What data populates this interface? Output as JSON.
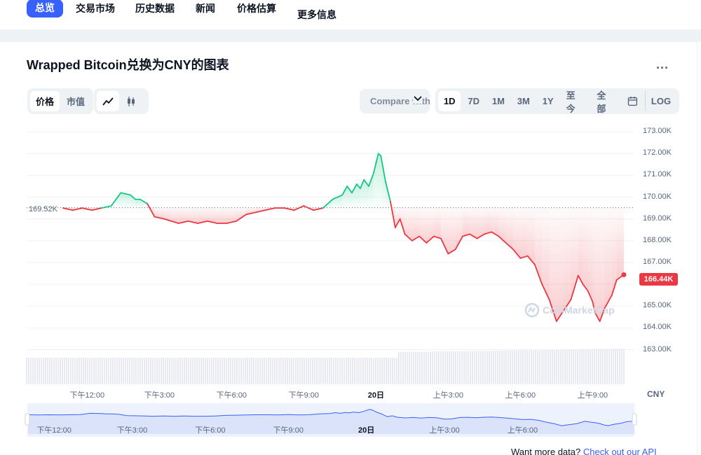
{
  "nav": {
    "items": [
      "总览",
      "交易市场",
      "历史数据",
      "新闻",
      "价格估算",
      "更多信息"
    ],
    "active": "总览"
  },
  "header": {
    "title": "Wrapped Bitcoin兑换为CNY的图表",
    "more": "..."
  },
  "toolbar": {
    "metric_tabs": [
      "价格",
      "市值"
    ],
    "compare_label": "Compare with",
    "ranges": [
      "1D",
      "7D",
      "1M",
      "3M",
      "1Y",
      "至今",
      "全部"
    ],
    "log_label": "LOG"
  },
  "chart_data": {
    "type": "line",
    "title": "Wrapped Bitcoin兑换为CNY的图表",
    "unit_label": "CNY",
    "y_tick_labels": [
      "173.00K",
      "172.00K",
      "171.00K",
      "170.00K",
      "169.00K",
      "168.00K",
      "167.00K",
      "166.00K",
      "165.00K",
      "164.00K",
      "163.00K"
    ],
    "ylim": [
      162.6,
      173.2
    ],
    "x_tick_labels": [
      "下午12:00",
      "下午3:00",
      "下午6:00",
      "下午9:00",
      "20日",
      "上午3:00",
      "上午6:00",
      "上午9:00"
    ],
    "x_tick_positions_hours": [
      1,
      4,
      7,
      10,
      13,
      16,
      19,
      22
    ],
    "xlim_hours": [
      0,
      23.3
    ],
    "reference_price": 169.52,
    "reference_label": "169.52K",
    "current_price": 166.44,
    "current_label": "166.44K",
    "series": [
      {
        "x": [
          0,
          0.4,
          0.8,
          1.2,
          1.6,
          2.0,
          2.4,
          2.8,
          3.0,
          3.2,
          3.5,
          3.8,
          4.2,
          4.5,
          4.8,
          5.2,
          5.6,
          6.0,
          6.4,
          6.8,
          7.2,
          7.6,
          8.0,
          8.4,
          8.8,
          9.2,
          9.6,
          10.0,
          10.4,
          10.8,
          11.2,
          11.6,
          11.8,
          12.0,
          12.2,
          12.35,
          12.5,
          12.7,
          12.9,
          13.1,
          13.2,
          13.3,
          13.4,
          13.6,
          13.8,
          14.0,
          14.2,
          14.5,
          14.8,
          15.1,
          15.4,
          15.7,
          16.0,
          16.3,
          16.6,
          16.9,
          17.2,
          17.5,
          17.8,
          18.1,
          18.4,
          18.7,
          19.0,
          19.3,
          19.6,
          19.9,
          20.2,
          20.5,
          20.8,
          21.1,
          21.4,
          21.6,
          21.8,
          22.0,
          22.1,
          22.3,
          22.5,
          22.8,
          23.0,
          23.3
        ],
        "y": [
          169.5,
          169.4,
          169.5,
          169.4,
          169.5,
          169.6,
          170.2,
          170.1,
          169.9,
          169.9,
          169.7,
          169.1,
          169.0,
          168.9,
          168.8,
          168.9,
          168.8,
          168.9,
          168.8,
          168.8,
          168.9,
          169.2,
          169.3,
          169.4,
          169.5,
          169.5,
          169.4,
          169.6,
          169.4,
          169.5,
          169.9,
          170.1,
          170.5,
          170.2,
          170.6,
          170.4,
          170.8,
          170.5,
          171.1,
          172.0,
          171.9,
          171.3,
          170.7,
          169.8,
          168.6,
          169.0,
          168.3,
          168.0,
          168.2,
          167.9,
          168.2,
          168.1,
          167.4,
          167.6,
          168.2,
          168.3,
          168.1,
          168.3,
          168.4,
          168.2,
          167.9,
          167.6,
          167.2,
          167.3,
          166.9,
          166.0,
          165.3,
          164.3,
          164.8,
          165.3,
          166.4,
          166.0,
          165.7,
          165.2,
          164.7,
          164.3,
          164.9,
          165.5,
          166.2,
          166.44
        ]
      }
    ],
    "grid": true,
    "watermark": "CoinMarketCap"
  },
  "navigator": {
    "x_tick_labels": [
      "下午12:00",
      "下午3:00",
      "下午6:00",
      "下午9:00",
      "20日",
      "上午3:00",
      "上午6:00"
    ]
  },
  "footer": {
    "text": "Want more data?",
    "link": "Check out our API"
  },
  "colors": {
    "up": "#16c784",
    "down": "#ea3943",
    "accent": "#3861fb"
  }
}
